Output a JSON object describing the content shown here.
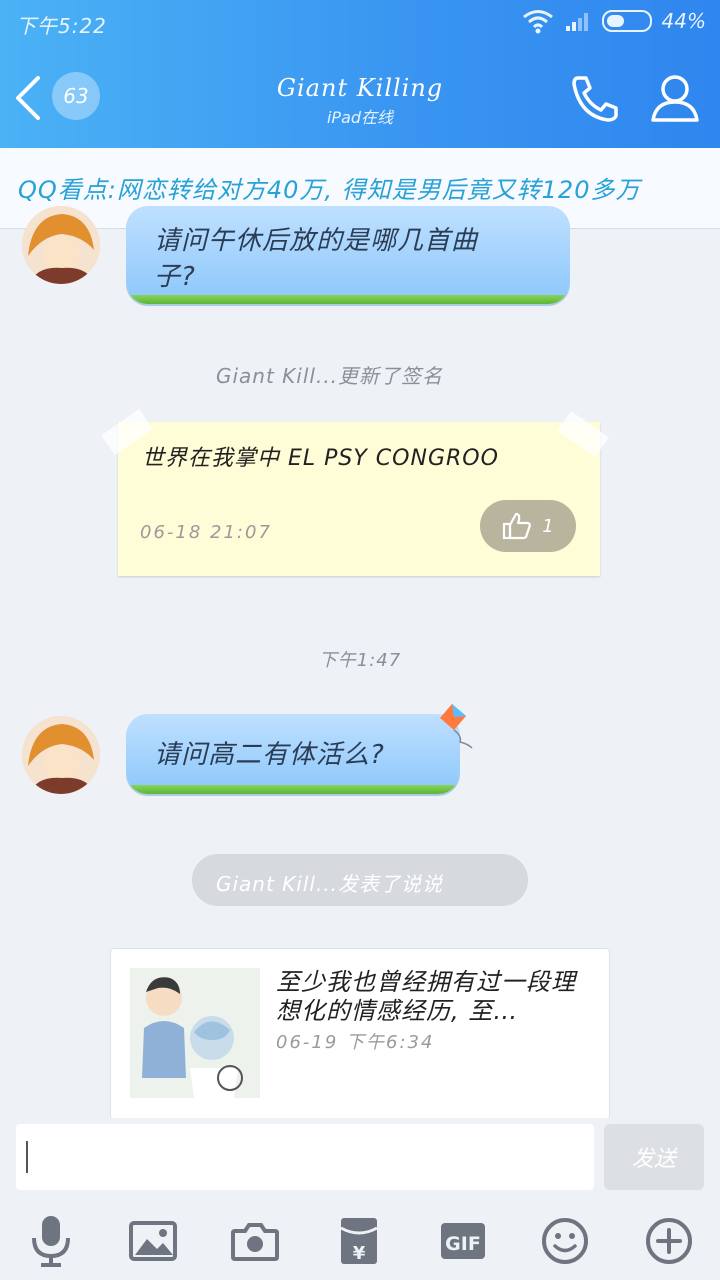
{
  "status": {
    "time": "下午5:22",
    "battery": "44%",
    "battery_level": 0.44
  },
  "header": {
    "unread_count": "63",
    "title": "Giant  Killing",
    "subtitle": "iPad在线"
  },
  "banner": {
    "text": "QQ看点:网恋转给对方40万, 得知是男后竟又转120多万"
  },
  "messages": {
    "first_bubble_line1": "请问午休后放的是哪几首曲",
    "first_bubble_line2": "子?",
    "sys_signature": "Giant  Kill...更新了签名",
    "signature_text": "世界在我掌中  EL  PSY  CONGROO",
    "signature_date": "06-18  21:07",
    "signature_likes": "1",
    "timestamp": "下午1:47",
    "second_bubble": "请问高二有体活么?",
    "sys_post": "Giant  Kill...发表了说说"
  },
  "post_card": {
    "text": "至少我也曾经拥有过一段理想化的情感经历, 至…",
    "date": "06-19  下午6:34"
  },
  "input": {
    "placeholder": "",
    "send_label": "发送"
  },
  "toolbar": {
    "icons": [
      "microphone-icon",
      "image-icon",
      "camera-icon",
      "red-packet-icon",
      "gif-icon",
      "emoji-icon",
      "plus-icon"
    ],
    "gif_label": "GIF",
    "yen": "¥"
  }
}
